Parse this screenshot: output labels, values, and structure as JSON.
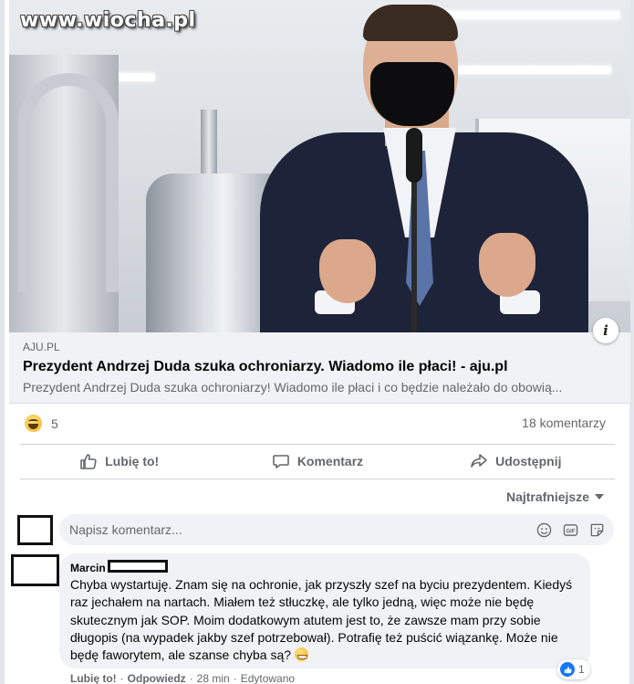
{
  "post": {
    "watermark": "www.wiocha.pl",
    "info_glyph": "i",
    "link": {
      "domain": "AJU.PL",
      "title": "Prezydent Andrzej Duda szuka ochroniarzy. Wiadomo ile płaci! - aju.pl",
      "description": "Prezydent Andrzej Duda szuka ochroniarzy! Wiadomo ile płaci i co będzie należało do obowią..."
    },
    "reactions": {
      "icon": "haha-reaction-icon",
      "count": "5"
    },
    "comment_count": "18 komentarzy",
    "actions": {
      "like": "Lubię to!",
      "comment": "Komentarz",
      "share": "Udostępnij"
    },
    "sort_label": "Najtrafniejsze"
  },
  "comment_input": {
    "placeholder": "Napisz komentarz..."
  },
  "comment": {
    "author": "Marcin",
    "text": "Chyba wystartuję. Znam się na ochronie, jak przyszły szef na byciu prezydentem. Kiedyś raz jechałem na nartach. Miałem też stłuczkę, ale tylko jedną, więc może nie będę skutecznym jak SOP. Moim dodatkowym atutem jest to, że zawsze mam przy sobie długopis (na wypadek jakby szef potrzebował). Potrafię też puścić wiązankę. Może nie będę faworytem, ale szanse chyba są?",
    "like_count": "1",
    "like_action": "Lubię to!",
    "reply_action": "Odpowiedz",
    "time": "28 min",
    "edited": "Edytowano",
    "separator": "·"
  },
  "colors": {
    "accent": "#1877f2",
    "secondary_text": "#65676b",
    "bubble": "#f0f2f5"
  }
}
